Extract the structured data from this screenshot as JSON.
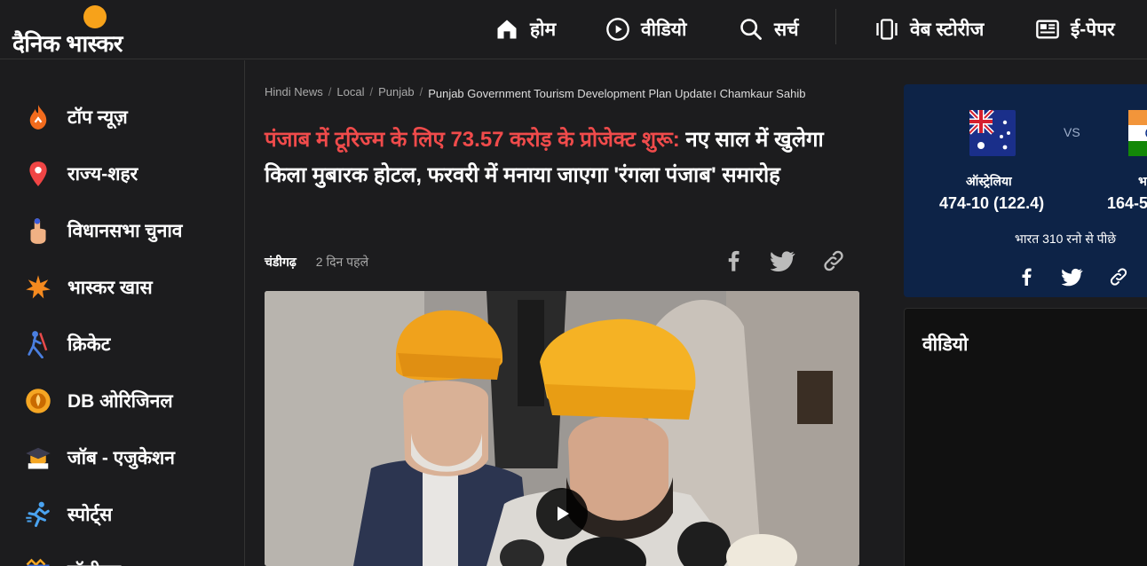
{
  "header": {
    "logo_text": "दैनिक भास्कर",
    "nav": [
      {
        "label": "होम",
        "icon": "home-icon"
      },
      {
        "label": "वीडियो",
        "icon": "play-circle-icon"
      },
      {
        "label": "सर्च",
        "icon": "search-icon"
      },
      {
        "label": "वेब स्टोरीज",
        "icon": "web-stories-icon"
      },
      {
        "label": "ई-पेपर",
        "icon": "newspaper-icon"
      }
    ]
  },
  "sidebar": {
    "items": [
      {
        "label": "टॉप न्यूज़",
        "icon": "fire-icon"
      },
      {
        "label": "राज्य-शहर",
        "icon": "location-pin-icon"
      },
      {
        "label": "विधानसभा चुनाव",
        "icon": "voting-finger-icon"
      },
      {
        "label": "भास्कर खास",
        "icon": "star-burst-icon"
      },
      {
        "label": "क्रिकेट",
        "icon": "cricket-icon"
      },
      {
        "label": "DB ओरिजिनल",
        "icon": "db-original-icon"
      },
      {
        "label": "जॉब - एजुकेशन",
        "icon": "graduation-cap-icon"
      },
      {
        "label": "स्पोर्ट्स",
        "icon": "runner-icon"
      },
      {
        "label": "बॉलीवुड",
        "icon": "film-icon"
      }
    ]
  },
  "article": {
    "breadcrumbs": [
      "Hindi News",
      "Local",
      "Punjab",
      "Punjab Government Tourism Development Plan Update। Chamkaur Sahib"
    ],
    "headline_red": "पंजाब में टूरिज्म के लिए 73.57 करोड़ के प्रोजेक्ट शुरू:",
    "headline_rest": " नए साल में खुलेगा किला मुबारक होटल, फरवरी में मनाया जाएगा 'रंगला पंजाब' समारोह",
    "city": "चंडीगढ़",
    "time": "2 दिन पहले",
    "share_icons": [
      "facebook-icon",
      "twitter-icon",
      "link-icon"
    ]
  },
  "score_card": {
    "vs": "VS",
    "team1": {
      "name": "ऑस्ट्रेलिया",
      "score": "474-10 (122.4)"
    },
    "team2": {
      "name": "भारत",
      "score": "164-5"
    },
    "status": "भारत 310 रनो से पीछे"
  },
  "video_card": {
    "title": "वीडियो"
  },
  "colors": {
    "background": "#1c1c1e",
    "headline_accent": "#f04b4b",
    "logo_sun": "#f7a21a",
    "score_card_bg": "#0d2347"
  }
}
